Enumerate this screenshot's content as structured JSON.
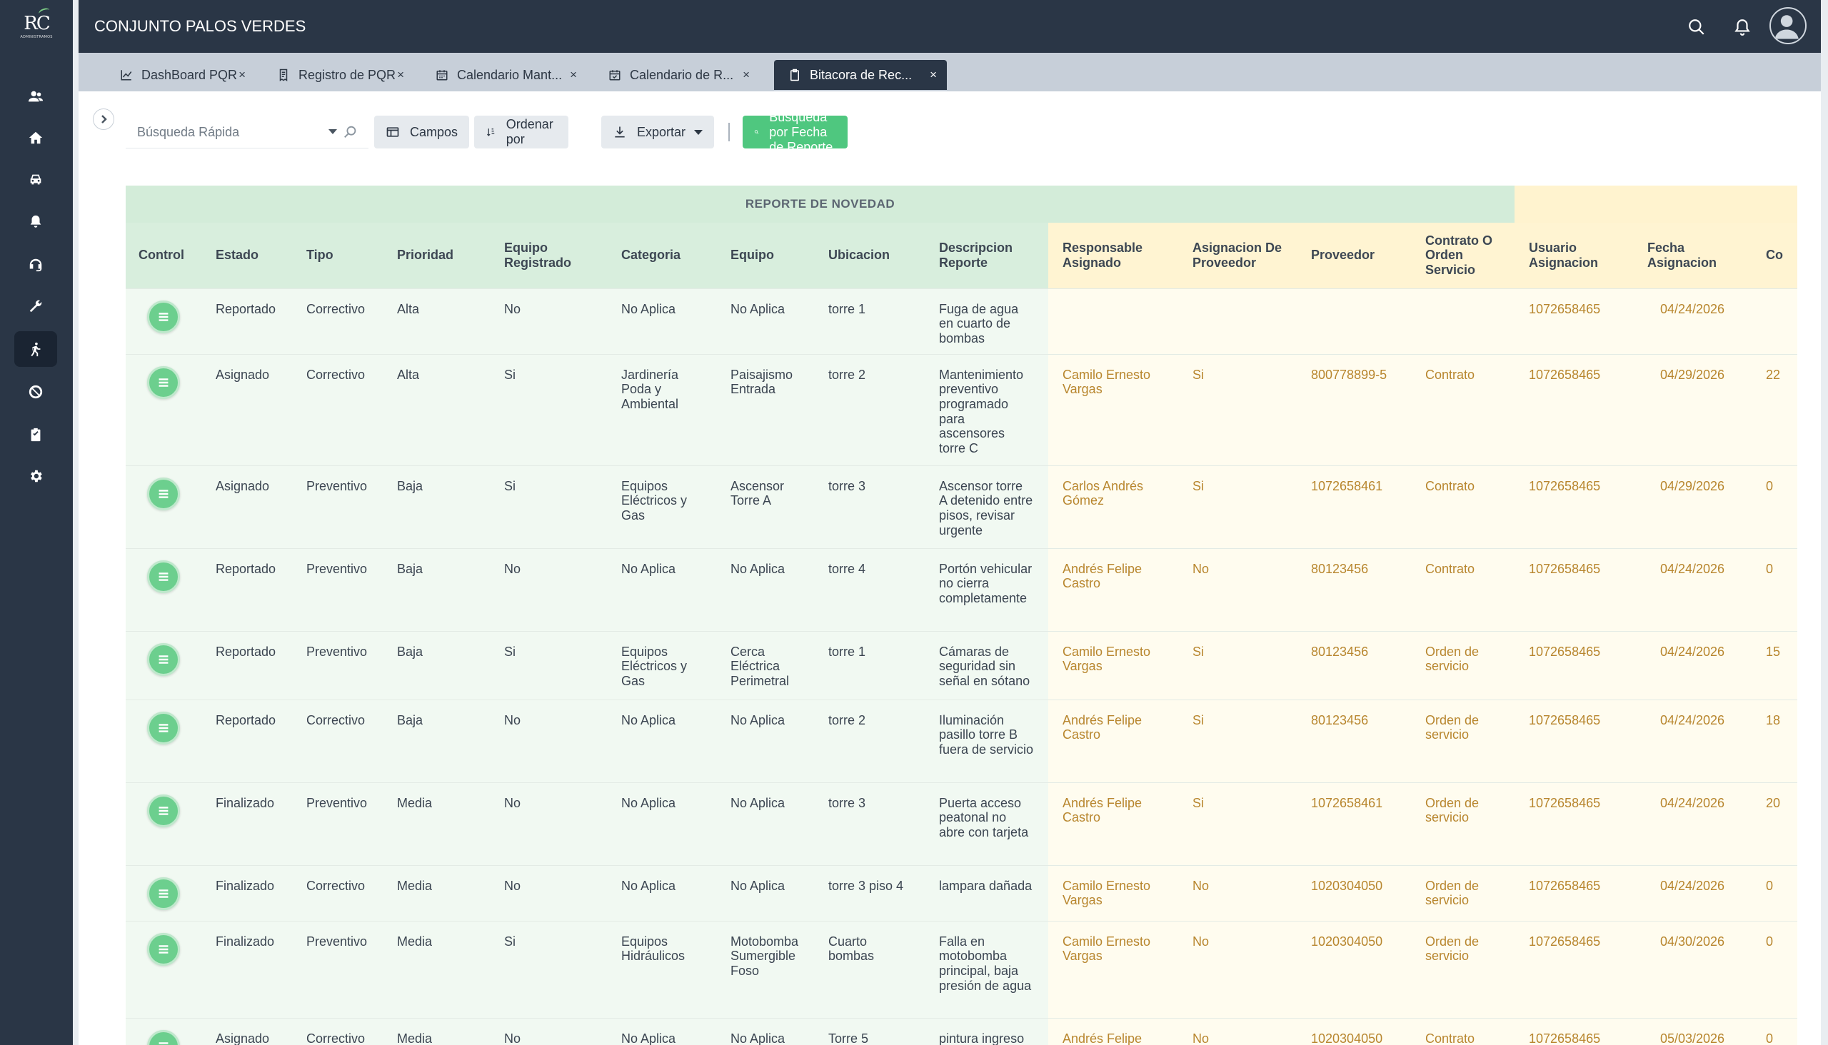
{
  "app": {
    "title": "CONJUNTO PALOS VERDES",
    "logo_text": "RC",
    "logo_subtitle": "ADMINISTRAMOS"
  },
  "sidebar": {
    "items": [
      {
        "icon": "users-icon"
      },
      {
        "icon": "home-icon"
      },
      {
        "icon": "car-icon"
      },
      {
        "icon": "bell-icon"
      },
      {
        "icon": "support-headset-icon"
      },
      {
        "icon": "wrench-icon"
      },
      {
        "icon": "person-walking-icon",
        "active": true
      },
      {
        "icon": "ban-icon"
      },
      {
        "icon": "clipboard-icon"
      },
      {
        "icon": "gear-icon"
      }
    ]
  },
  "tabs": [
    {
      "label": "DashBoard PQR",
      "icon": "chart-line-icon",
      "close": "×"
    },
    {
      "label": "Registro de PQR",
      "icon": "receipt-icon",
      "close": "×"
    },
    {
      "label": "Calendario Mant...",
      "icon": "calendar-icon",
      "close": "×"
    },
    {
      "label": "Calendario de R...",
      "icon": "calendar-check-icon",
      "close": "×"
    },
    {
      "label": "Bitacora de Rec...",
      "icon": "clipboard-icon",
      "close": "×",
      "active": true
    }
  ],
  "toolbar": {
    "search_placeholder": "Búsqueda Rápida",
    "campos": "Campos",
    "ordenar": "Ordenar por",
    "exportar": "Exportar",
    "date_search": "Busqueda por Fecha de Reporte"
  },
  "table": {
    "group_header": "REPORTE DE NOVEDAD",
    "columns": [
      "Control",
      "Estado",
      "Tipo",
      "Prioridad",
      "Equipo Registrado",
      "Categoria",
      "Equipo",
      "Ubicacion",
      "Descripcion Reporte",
      "Responsable Asignado",
      "Asignacion De Proveedor",
      "Proveedor",
      "Contrato O Orden Servicio",
      "Usuario Asignacion",
      "Fecha Asignacion",
      "Co"
    ],
    "rows": [
      [
        "",
        "Reportado",
        "Correctivo",
        "Alta",
        "No",
        "No Aplica",
        "No Aplica",
        "torre 1",
        "Fuga de agua en cuarto de bombas",
        "",
        "",
        "",
        "",
        "1072658465",
        "04/24/2026",
        ""
      ],
      [
        "",
        "Asignado",
        "Correctivo",
        "Alta",
        "Si",
        "Jardinería Poda y Ambiental",
        "Paisajismo Entrada",
        "torre 2",
        "Mantenimiento preventivo programado para ascensores torre C",
        "Camilo Ernesto Vargas",
        "Si",
        "800778899-5",
        "Contrato",
        "1072658465",
        "04/29/2026",
        "22"
      ],
      [
        "",
        "Asignado",
        "Preventivo",
        "Baja",
        "Si",
        "Equipos Eléctricos y Gas",
        "Ascensor Torre A",
        "torre 3",
        "Ascensor torre A detenido entre pisos, revisar urgente",
        "Carlos Andrés Gómez",
        "Si",
        "1072658461",
        "Contrato",
        "1072658465",
        "04/29/2026",
        "0"
      ],
      [
        "",
        "Reportado",
        "Preventivo",
        "Baja",
        "No",
        "No Aplica",
        "No Aplica",
        "torre 4",
        "Portón vehicular no cierra completamente",
        "Andrés Felipe Castro",
        "No",
        "80123456",
        "Contrato",
        "1072658465",
        "04/24/2026",
        "0"
      ],
      [
        "",
        "Reportado",
        "Preventivo",
        "Baja",
        "Si",
        "Equipos Eléctricos y Gas",
        "Cerca Eléctrica Perimetral",
        "torre 1",
        "Cámaras de seguridad sin señal en sótano",
        "Camilo Ernesto Vargas",
        "Si",
        "80123456",
        "Orden de servicio",
        "1072658465",
        "04/24/2026",
        "15"
      ],
      [
        "",
        "Reportado",
        "Correctivo",
        "Baja",
        "No",
        "No Aplica",
        "No Aplica",
        "torre 2",
        "Iluminación pasillo torre B fuera de servicio",
        "Andrés Felipe Castro",
        "Si",
        "80123456",
        "Orden de servicio",
        "1072658465",
        "04/24/2026",
        "18"
      ],
      [
        "",
        "Finalizado",
        "Preventivo",
        "Media",
        "No",
        "No Aplica",
        "No Aplica",
        "torre 3",
        "Puerta acceso peatonal no abre con tarjeta",
        "Andrés Felipe Castro",
        "Si",
        "1072658461",
        "Orden de servicio",
        "1072658465",
        "04/24/2026",
        "20"
      ],
      [
        "",
        "Finalizado",
        "Correctivo",
        "Media",
        "No",
        "No Aplica",
        "No Aplica",
        "torre 3 piso 4",
        "lampara dañada",
        "Camilo Ernesto Vargas",
        "No",
        "1020304050",
        "Orden de servicio",
        "1072658465",
        "04/24/2026",
        "0"
      ],
      [
        "",
        "Finalizado",
        "Preventivo",
        "Media",
        "Si",
        "Equipos Hidráulicos",
        "Motobomba Sumergible Foso",
        "Cuarto bombas",
        "Falla en motobomba principal, baja presión de agua",
        "Camilo Ernesto Vargas",
        "No",
        "1020304050",
        "Orden de servicio",
        "1072658465",
        "04/30/2026",
        "0"
      ],
      [
        "",
        "Asignado",
        "Correctivo",
        "Media",
        "No",
        "No Aplica",
        "No Aplica",
        "Torre 5",
        "pintura ingreso",
        "Andrés Felipe",
        "No",
        "1020304050",
        "Contrato",
        "1072658465",
        "05/03/2026",
        "0"
      ]
    ]
  },
  "colors": {
    "sidebar": "#2a3646",
    "accent_green": "#4fc77f",
    "group_green": "#d3ecd9",
    "group_yellow": "#fff3cf",
    "assignment_text": "#b8862e"
  }
}
